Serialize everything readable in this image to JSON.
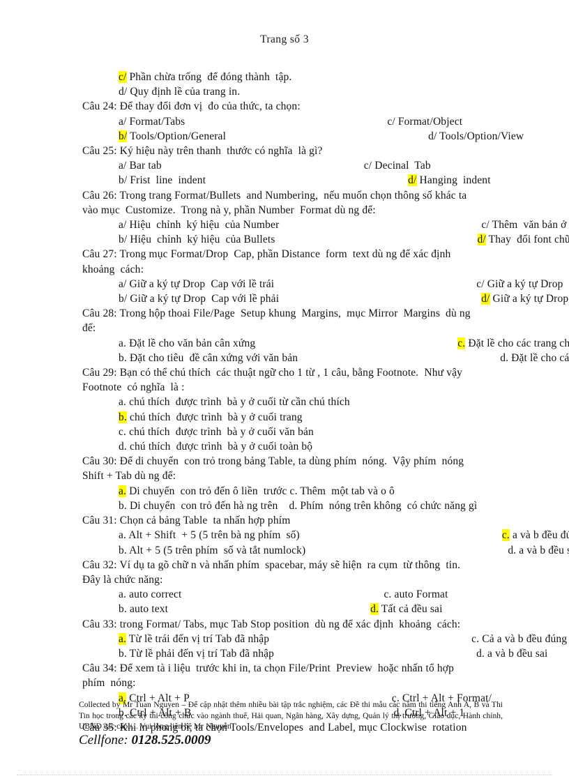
{
  "header": {
    "page_label": "Trang số 3"
  },
  "content": {
    "lines": [
      {
        "type": "option",
        "prefix": "c/",
        "prefix_highlighted": true,
        "text": " Phần chừa trống  để đóng thành  tập.",
        "col2": "",
        "col2_prefix": "",
        "col2_highlighted": false
      },
      {
        "type": "option",
        "prefix": "d/",
        "prefix_highlighted": false,
        "text": " Quy định lề của trang in.",
        "col2": "",
        "col2_prefix": "",
        "col2_highlighted": false
      },
      {
        "type": "question",
        "text": "Câu 24: Để thay đổi đơn vị  đo của thức, ta chọn:"
      },
      {
        "type": "option",
        "prefix": "a/",
        "prefix_highlighted": false,
        "text": " Format/Tabs",
        "col2_prefix": "c/",
        "col2": " Format/Object",
        "col2_highlighted": false
      },
      {
        "type": "option",
        "prefix": "b/",
        "prefix_highlighted": true,
        "text": " Tools/Option/General",
        "col2_prefix": "d/",
        "col2": " Tools/Option/View",
        "col2_highlighted": false
      },
      {
        "type": "question",
        "text": "Câu 25: Ký hiệu này trên thanh  thước có nghĩa  là gì?"
      },
      {
        "type": "option",
        "prefix": "a/",
        "prefix_highlighted": false,
        "text": " Bar tab",
        "col2_prefix": "c/",
        "col2": " Decinal  Tab",
        "col2_highlighted": false
      },
      {
        "type": "option",
        "prefix": "b/",
        "prefix_highlighted": false,
        "text": " Frist  line  indent",
        "col2_prefix": "d/",
        "col2": " Hanging  indent",
        "col2_highlighted": true
      },
      {
        "type": "question",
        "text": "Câu 26: Trong trang Format/Bullets  and Numbering,  nếu muốn chọn thông số khác ta"
      },
      {
        "type": "continuation",
        "text": "vào mục  Customize.  Trong nà y, phần Number  Format dù ng để:"
      },
      {
        "type": "option",
        "prefix": "a/",
        "prefix_highlighted": false,
        "text": " Hiệu  chỉnh  ký hiệu  của Number",
        "col2_prefix": "c/",
        "col2": " Thêm  văn bản ở trước, sau dấu hoa thị",
        "col2_highlighted": false
      },
      {
        "type": "option",
        "prefix": "b/",
        "prefix_highlighted": false,
        "text": " Hiệu  chỉnh  ký hiệu  của Bullets",
        "col2_prefix": "d/",
        "col2": " Thay  đổi font chữ",
        "col2_highlighted": true
      },
      {
        "type": "question",
        "text": "Câu 27: Trong mục Format/Drop  Cap, phần Distance  form  text dù ng để xác định"
      },
      {
        "type": "continuation",
        "text": "khoảng  cách:"
      },
      {
        "type": "option",
        "prefix": "a/",
        "prefix_highlighted": false,
        "text": " Giữ a ký tự Drop  Cap với lề trái",
        "col2_prefix": "c/",
        "col2": " Giữ a ký tự Drop  Cap với ký tự tiếp theo",
        "col2_highlighted": false
      },
      {
        "type": "option",
        "prefix": "b/",
        "prefix_highlighted": false,
        "text": " Giữ a ký tự Drop  Cap với lề phải",
        "col2_prefix": "d/",
        "col2": " Giữ a ký tự Drop  Cap với toà n văn bản",
        "col2_highlighted": true
      },
      {
        "type": "question",
        "text": "Câu 28: Trong hộp thoai File/Page  Setup khung  Margins,  mục Mirror  Margins  dù ng"
      },
      {
        "type": "continuation",
        "text": "để:"
      },
      {
        "type": "option",
        "prefix": "a.",
        "prefix_highlighted": false,
        "text": " Đặt lề cho văn bản cân xứng",
        "col2_prefix": "c.",
        "col2": " Đặt lề cho các trang chẵn và lẻ đối xứng",
        "col2_highlighted": true
      },
      {
        "type": "option",
        "prefix": "b.",
        "prefix_highlighted": false,
        "text": " Đặt cho tiêu  đề cân xứng với văn bản",
        "col2_prefix": "d.",
        "col2": " Đặt lề cho các section  đối xứng nhau",
        "col2_highlighted": false
      },
      {
        "type": "question",
        "text": "Câu 29: Bạn có thể chú thích  các thuật ngữ cho 1 từ , 1 câu, bằng Footnote.  Như vậy"
      },
      {
        "type": "continuation",
        "text": "Footnote  có nghĩa  là :"
      },
      {
        "type": "option",
        "prefix": "a.",
        "prefix_highlighted": false,
        "text": " chú thích  được trình  bà y ở cuối từ cần chú thích",
        "col2_prefix": "",
        "col2": "",
        "col2_highlighted": false
      },
      {
        "type": "option",
        "prefix": "b.",
        "prefix_highlighted": true,
        "text": " chú thích  được trình  bà y ở cuối trang",
        "col2_prefix": "",
        "col2": "",
        "col2_highlighted": false
      },
      {
        "type": "option",
        "prefix": "c.",
        "prefix_highlighted": false,
        "text": " chú thích  được trình  bà y ở cuối văn bản",
        "col2_prefix": "",
        "col2": "",
        "col2_highlighted": false
      },
      {
        "type": "option",
        "prefix": "d.",
        "prefix_highlighted": false,
        "text": " chú thích  được trình  bà y ở cuối toàn bộ",
        "col2_prefix": "",
        "col2": "",
        "col2_highlighted": false
      },
      {
        "type": "question",
        "text": "Câu 30: Để di chuyển  con trỏ trong bảng Table, ta dùng phím  nóng.  Vậy phím  nóng"
      },
      {
        "type": "continuation",
        "text": "Shift + Tab dù ng để:"
      },
      {
        "type": "option",
        "prefix": "a.",
        "prefix_highlighted": true,
        "text": " Di chuyển  con trỏ đến ô liền  trước c. Thêm  một tab và o ô",
        "col2_prefix": "",
        "col2": "",
        "col2_highlighted": false
      },
      {
        "type": "option",
        "prefix": "b.",
        "prefix_highlighted": false,
        "text": " Di chuyển  con trỏ đến hà ng trên    d. Phím  nóng trên không  có chức năng gì",
        "col2_prefix": "",
        "col2": "",
        "col2_highlighted": false
      },
      {
        "type": "question",
        "text": "Câu 31: Chọn cả bảng Table  ta nhấn hợp phím"
      },
      {
        "type": "option",
        "prefix": "a.",
        "prefix_highlighted": false,
        "text": " Alt + Shift  + 5 (5 trên bà ng phím  số)",
        "col2_prefix": "c.",
        "col2": " a và b đều đúng",
        "col2_highlighted": true
      },
      {
        "type": "option",
        "prefix": "b.",
        "prefix_highlighted": false,
        "text": " Alt + 5 (5 trên phím  số và tắt numlock)",
        "col2_prefix": "d.",
        "col2": " a và b đều sai",
        "col2_highlighted": false
      },
      {
        "type": "question",
        "text": "Câu 32: Ví dụ ta gõ chữ n và nhấn phím  spacebar, máy sẽ hiện  ra cụm  từ thông  tin."
      },
      {
        "type": "continuation",
        "text": "Đây là chức năng:"
      },
      {
        "type": "option",
        "prefix": "a.",
        "prefix_highlighted": false,
        "text": " auto correct",
        "col2_prefix": "c.",
        "col2": " auto Format",
        "col2_highlighted": false
      },
      {
        "type": "option",
        "prefix": "b.",
        "prefix_highlighted": false,
        "text": " auto text",
        "col2_prefix": "d.",
        "col2": " Tất cả đều sai",
        "col2_highlighted": true
      },
      {
        "type": "question",
        "text": "Câu 33: trong Format/ Tabs, mục Tab Stop position  dù ng để xác định  khoảng  cách:"
      },
      {
        "type": "option",
        "prefix": "a.",
        "prefix_highlighted": true,
        "text": " Từ lề trái đến vị trí Tab đã nhập",
        "col2_prefix": "c.",
        "col2": " Cả a và b đều đúng",
        "col2_highlighted": false
      },
      {
        "type": "option",
        "prefix": "b.",
        "prefix_highlighted": false,
        "text": " Từ lề phải đến vị trí Tab đã nhập",
        "col2_prefix": "d.",
        "col2": " a và b đều sai",
        "col2_highlighted": false
      },
      {
        "type": "question",
        "text": "Câu 34: Để xem tà i liệu  trước khi in, ta chọn File/Print  Preview  hoặc nhấn tổ hợp"
      },
      {
        "type": "continuation",
        "text": "phím  nóng:"
      },
      {
        "type": "option",
        "prefix": "a.",
        "prefix_highlighted": true,
        "text": " Ctrl + Alt + P",
        "col2_prefix": "c.",
        "col2": " Ctrl + Alt + Format/",
        "col2_highlighted": false
      },
      {
        "type": "option",
        "prefix": "b.",
        "prefix_highlighted": false,
        "text": " Ctrl + Alt + B",
        "col2_prefix": "d.",
        "col2": " Ctrl + Alt + 1",
        "col2_highlighted": false
      },
      {
        "type": "question",
        "text": "Câu 35: Khi in phong bì, ta chọn Tools/Envelopes  and Label, mục Clockwise  rotation"
      }
    ]
  },
  "footer": {
    "note_line1": "Collected by Mr Tuan Nguyen – Để cập nhật thêm nhiều bài tập trắc nghiệm,  các Đề thi mẫu các năm thi",
    "note_line2": "tiếng Anh A, B  và Thi Tin  học trong các kỳ thi công chức vào ngành thuế, Hải  quan, Ngân hàng, Xây",
    "note_line3": "dựng, Quản lý thị trường, Giáo  dục, Hành chính, UBND  các cấp./... Vui lòng liên hệ Mr Nguyễn",
    "cellfone_label": "Cellfone: ",
    "cellfone_number": "0128.525.0009"
  },
  "colors": {
    "highlight": "#ffff00",
    "text": "#141414",
    "paper": "#ffffff"
  }
}
